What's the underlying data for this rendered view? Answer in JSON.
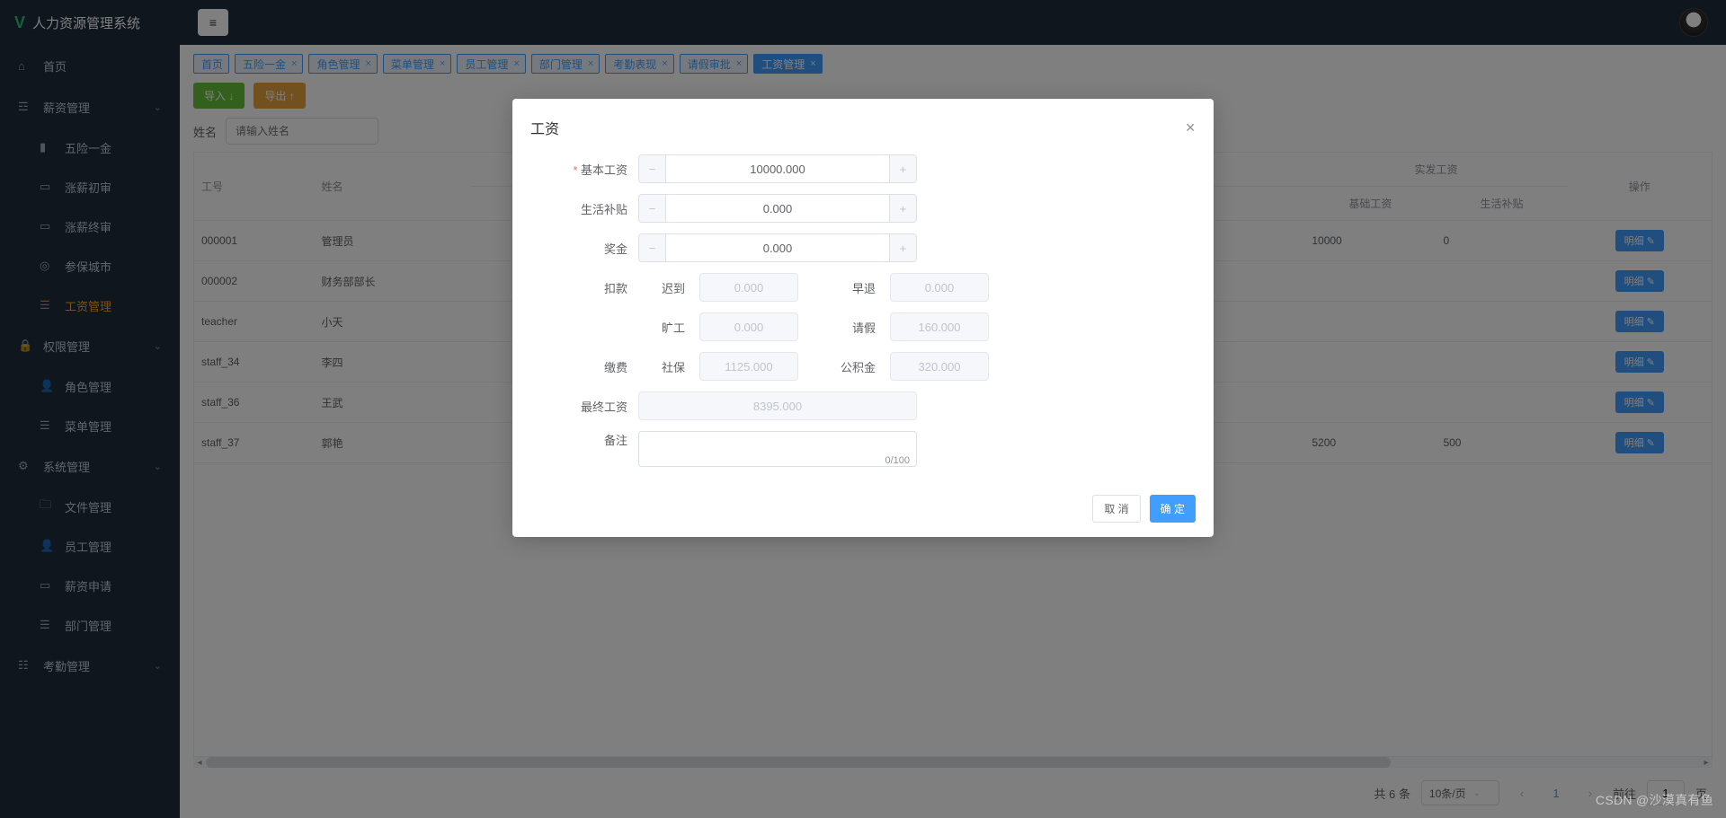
{
  "app_title": "人力资源管理系统",
  "sidebar": {
    "home": "首页",
    "salary_mgmt": "薪资管理",
    "salary_sub": {
      "insurance": "五险一金",
      "raise_initial": "涨薪初审",
      "raise_final": "涨薪终审",
      "insured_city": "参保城市",
      "salary": "工资管理"
    },
    "perm_mgmt": "权限管理",
    "perm_sub": {
      "role": "角色管理",
      "menu": "菜单管理"
    },
    "system_mgmt": "系统管理",
    "system_sub": {
      "file": "文件管理",
      "staff": "员工管理",
      "salary_apply": "薪资申请",
      "dept": "部门管理"
    },
    "attendance_mgmt": "考勤管理"
  },
  "tabs": [
    {
      "label": "首页",
      "closable": false
    },
    {
      "label": "五险一金",
      "closable": true
    },
    {
      "label": "角色管理",
      "closable": true
    },
    {
      "label": "菜单管理",
      "closable": true
    },
    {
      "label": "员工管理",
      "closable": true
    },
    {
      "label": "部门管理",
      "closable": true
    },
    {
      "label": "考勤表现",
      "closable": true
    },
    {
      "label": "请假审批",
      "closable": true
    },
    {
      "label": "工资管理",
      "closable": true,
      "active": true
    }
  ],
  "toolbar": {
    "import": "导入 ↓",
    "export": "导出 ↑"
  },
  "search": {
    "label": "姓名",
    "placeholder": "请输入姓名"
  },
  "table": {
    "headers": {
      "emp_no": "工号",
      "name": "姓名",
      "group": "实发工资",
      "base_salary": "基础工资",
      "allowance": "生活补贴",
      "op": "操作"
    },
    "detail_btn": "明细",
    "rows": [
      {
        "emp_no": "000001",
        "name": "管理员",
        "base": "10000",
        "allow": "0"
      },
      {
        "emp_no": "000002",
        "name": "财务部部长",
        "base": "",
        "allow": ""
      },
      {
        "emp_no": "teacher",
        "name": "小天",
        "base": "",
        "allow": ""
      },
      {
        "emp_no": "staff_34",
        "name": "李四",
        "base": "",
        "allow": ""
      },
      {
        "emp_no": "staff_36",
        "name": "王武",
        "base": "",
        "allow": ""
      },
      {
        "emp_no": "staff_37",
        "name": "郭艳",
        "base": "5200",
        "allow": "500"
      }
    ]
  },
  "pagination": {
    "total_label": "共 6 条",
    "per_page": "10条/页",
    "goto_prefix": "前往",
    "goto_suffix": "页",
    "current": "1"
  },
  "dialog": {
    "title": "工资",
    "labels": {
      "base": "基本工资",
      "allowance": "生活补贴",
      "bonus": "奖金",
      "deduction": "扣款",
      "late": "迟到",
      "early": "早退",
      "absent": "旷工",
      "leave": "请假",
      "fees": "缴费",
      "social": "社保",
      "fund": "公积金",
      "final": "最终工资",
      "remark": "备注"
    },
    "values": {
      "base": "10000.000",
      "allowance": "0.000",
      "bonus": "0.000",
      "late": "0.000",
      "early": "0.000",
      "absent": "0.000",
      "leave": "160.000",
      "social": "1125.000",
      "fund": "320.000",
      "final": "8395.000",
      "remark_count": "0/100"
    },
    "buttons": {
      "cancel": "取 消",
      "confirm": "确 定"
    }
  },
  "watermark": "CSDN @沙漠真有鱼"
}
